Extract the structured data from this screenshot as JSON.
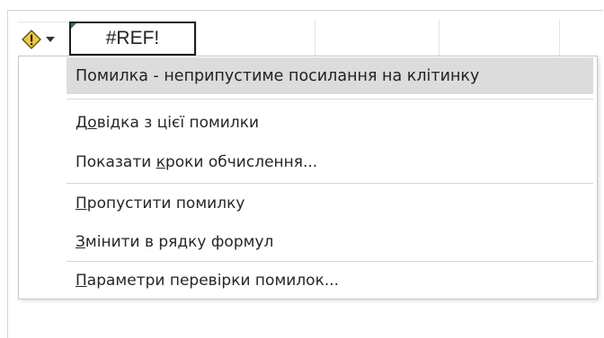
{
  "error_button": {
    "icon": "warning-icon",
    "dropdown_icon": "chevron-down-icon",
    "colors": {
      "diamond": "#f2c744",
      "diamond_border": "#5a4a10",
      "mark": "#222222"
    }
  },
  "cell": {
    "value": "#REF!",
    "indicator_color": "#1e8a3e"
  },
  "menu": {
    "title": "Помилка - неприпустиме посилання на клітинку",
    "items": [
      {
        "pre": "Д",
        "key": "о",
        "post": "відка з цієї помилки"
      },
      {
        "pre": "Показати ",
        "key": "к",
        "post": "роки обчислення..."
      },
      {
        "pre": "",
        "key": "П",
        "post": "ропустити помилку"
      },
      {
        "pre": "",
        "key": "З",
        "post": "мінити в рядку формул"
      },
      {
        "pre": "",
        "key": "П",
        "post": "араметри перевірки помилок..."
      }
    ]
  }
}
